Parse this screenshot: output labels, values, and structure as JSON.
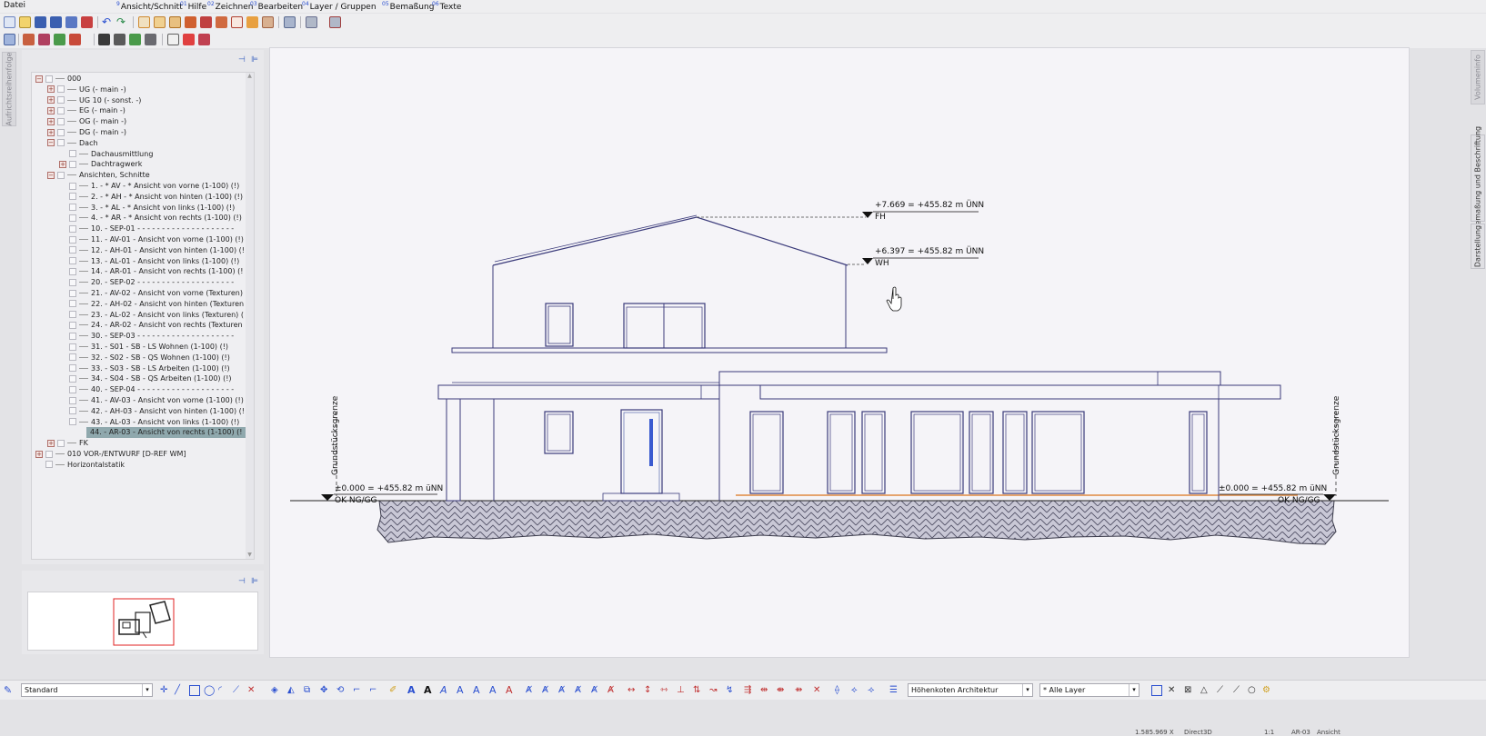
{
  "menu": {
    "datei": "Datei",
    "items": [
      {
        "num": "9",
        "label": "Ansicht/Schnitt"
      },
      {
        "num": "01",
        "label": "Hilfe"
      },
      {
        "num": "02",
        "label": "Zeichnen"
      },
      {
        "num": "03",
        "label": "Bearbeiten"
      },
      {
        "num": "04",
        "label": "Layer / Gruppen"
      },
      {
        "num": "05",
        "label": "Bemaßung"
      },
      {
        "num": "06",
        "label": "Texte"
      }
    ]
  },
  "left_tab": "Aufrichtsreihenfolge",
  "right_tabs": [
    "Volumeninfo",
    "Bemaßung und Beschriftung",
    "Darstellung"
  ],
  "tree": [
    {
      "indent": 0,
      "toggle": "−",
      "label": "000"
    },
    {
      "indent": 1,
      "toggle": "+",
      "label": "UG (- main -)"
    },
    {
      "indent": 1,
      "toggle": "+",
      "label": "UG 10 (- sonst. -)"
    },
    {
      "indent": 1,
      "toggle": "+",
      "label": "EG (- main -)"
    },
    {
      "indent": 1,
      "toggle": "+",
      "label": "OG (- main -)"
    },
    {
      "indent": 1,
      "toggle": "+",
      "label": "DG (- main -)"
    },
    {
      "indent": 1,
      "toggle": "−",
      "label": "Dach"
    },
    {
      "indent": 2,
      "toggle": "",
      "label": "Dachausmittlung"
    },
    {
      "indent": 2,
      "toggle": "+",
      "label": "Dachtragwerk"
    },
    {
      "indent": 1,
      "toggle": "−",
      "label": "Ansichten, Schnitte"
    },
    {
      "indent": 2,
      "toggle": "",
      "label": "1. - * AV - * Ansicht von vorne (1-100) (!)"
    },
    {
      "indent": 2,
      "toggle": "",
      "label": "2. - * AH - * Ansicht von hinten (1-100) (!)"
    },
    {
      "indent": 2,
      "toggle": "",
      "label": "3. - * AL - * Ansicht von links (1-100) (!)"
    },
    {
      "indent": 2,
      "toggle": "",
      "label": "4. - * AR - * Ansicht von rechts (1-100) (!)"
    },
    {
      "indent": 2,
      "toggle": "",
      "label": "10. - SEP-01 - - - - - - - - - - - - - - - - - - - -"
    },
    {
      "indent": 2,
      "toggle": "",
      "label": "11. - AV-01 - Ansicht von vorne (1-100) (!)"
    },
    {
      "indent": 2,
      "toggle": "",
      "label": "12. - AH-01 - Ansicht von hinten (1-100) (!"
    },
    {
      "indent": 2,
      "toggle": "",
      "label": "13. - AL-01 - Ansicht von links (1-100) (!)"
    },
    {
      "indent": 2,
      "toggle": "",
      "label": "14. - AR-01 - Ansicht von rechts (1-100) (!"
    },
    {
      "indent": 2,
      "toggle": "",
      "label": "20. - SEP-02 - - - - - - - - - - - - - - - - - - - -"
    },
    {
      "indent": 2,
      "toggle": "",
      "label": "21. - AV-02 - Ansicht von vorne (Texturen)"
    },
    {
      "indent": 2,
      "toggle": "",
      "label": "22. - AH-02 - Ansicht von hinten (Texturen"
    },
    {
      "indent": 2,
      "toggle": "",
      "label": "23. - AL-02 - Ansicht von links (Texturen) ("
    },
    {
      "indent": 2,
      "toggle": "",
      "label": "24. - AR-02 - Ansicht von rechts (Texturen"
    },
    {
      "indent": 2,
      "toggle": "",
      "label": "30. - SEP-03 - - - - - - - - - - - - - - - - - - - -"
    },
    {
      "indent": 2,
      "toggle": "",
      "label": "31. - S01 - SB - LS Wohnen (1-100) (!)"
    },
    {
      "indent": 2,
      "toggle": "",
      "label": "32. - S02 - SB - QS Wohnen (1-100) (!)"
    },
    {
      "indent": 2,
      "toggle": "",
      "label": "33. - S03 - SB - LS Arbeiten (1-100) (!)"
    },
    {
      "indent": 2,
      "toggle": "",
      "label": "34. - S04 - SB - QS Arbeiten (1-100) (!)"
    },
    {
      "indent": 2,
      "toggle": "",
      "label": "40. - SEP-04 - - - - - - - - - - - - - - - - - - - -"
    },
    {
      "indent": 2,
      "toggle": "",
      "label": "41. - AV-03 - Ansicht von vorne (1-100) (!)"
    },
    {
      "indent": 2,
      "toggle": "",
      "label": "42. - AH-03 - Ansicht von hinten (1-100) (!"
    },
    {
      "indent": 2,
      "toggle": "",
      "label": "43. - AL-03 - Ansicht von links (1-100) (!)"
    },
    {
      "indent": 2,
      "toggle": "",
      "label": "44. - AR-03 - Ansicht von rechts (1-100) (!",
      "selected": true
    },
    {
      "indent": 1,
      "toggle": "+",
      "label": "FK"
    },
    {
      "indent": 0,
      "toggle": "+",
      "label": "010 VOR-/ENTWURF [D-REF WM]"
    },
    {
      "indent": 0,
      "toggle": "",
      "label": "Horizontalstatik"
    }
  ],
  "drawing": {
    "fh_value": "+7.669 = +455.82 m ÜNN",
    "fh_label": "FH",
    "wh_value": "+6.397 = +455.82 m ÜNN",
    "wh_label": "WH",
    "left_level": "±0.000 = +455.82 m üNN",
    "left_level_sub": "OK NG/GG",
    "right_level": "±0.000 = +455.82 m üNN",
    "right_level_sub": "OK NG/GG",
    "boundary": "Grundstücksgrenze"
  },
  "bottom": {
    "pen_style": "Standard",
    "text_style": "Höhenkoten Architektur",
    "layer": "* Alle Layer"
  },
  "status": {
    "coords": "1.585.969 X",
    "mode": "Direct3D",
    "scale": "1:1",
    "plan": "AR-03",
    "view": "Ansicht"
  }
}
